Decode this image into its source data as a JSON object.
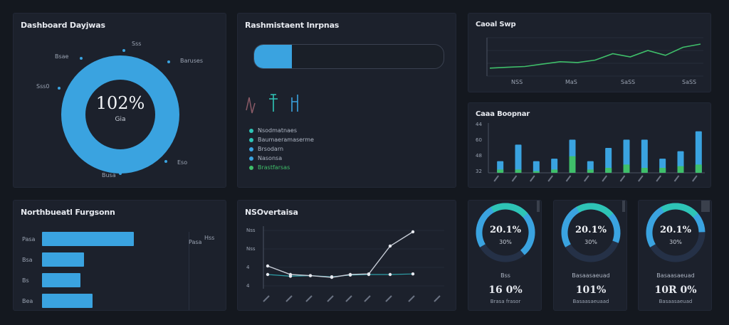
{
  "colors": {
    "background": "#14181f",
    "panel": "#1c212c",
    "accent_blue": "#3aa3e0",
    "accent_teal": "#2ec4b6",
    "accent_green": "#3fbf6a",
    "track": "#253147"
  },
  "donut_panel": {
    "title": "Dashboard Dayjwas",
    "value": "102%",
    "sub": "Gia",
    "labels": [
      "Bsae",
      "Sss",
      "Baruses",
      "Sss0",
      "Eso",
      "Busa"
    ],
    "percent": 100
  },
  "progress_panel": {
    "title": "Rashmistaent Inrpnas",
    "progress_value": 0.2,
    "legend": [
      {
        "label": "Nsodmatnaes",
        "color": "#2ec4b6"
      },
      {
        "label": "Baumaeramaserme",
        "color": "#2ec4b6"
      },
      {
        "label": "Brsodarn",
        "color": "#3aa3e0"
      },
      {
        "label": "Nasonsa",
        "color": "#3aa3e0"
      },
      {
        "label": "Brastfarsas",
        "color": "#3fbf6a"
      }
    ]
  },
  "spark_panel": {
    "title": "Caoal Swp",
    "x_labels": [
      "NSS",
      "MaS",
      "SaSS",
      "SaSS"
    ]
  },
  "bars_panel": {
    "title": "Caaa Boopnar",
    "y_labels": [
      "44",
      "60",
      "48",
      "32"
    ]
  },
  "hbar_panel": {
    "title": "Northbueatl Furgsonn",
    "rows": [
      {
        "label": "Pasa",
        "value": 0.83
      },
      {
        "label": "Bsa",
        "value": 0.38
      },
      {
        "label": "Bs",
        "value": 0.35
      },
      {
        "label": "Bea",
        "value": 0.46
      }
    ],
    "side_labels": [
      "Pasa",
      "Hss"
    ]
  },
  "line_panel": {
    "title": "NSOvertaisa",
    "y_labels": [
      "Nss",
      "Nss",
      "4",
      "4"
    ]
  },
  "gauges": [
    {
      "value": "20.1%",
      "sub": "30%",
      "label": "Bss",
      "big": "16 0%",
      "caption": "Brasa frasor",
      "fraction": 0.72
    },
    {
      "value": "20.1%",
      "sub": "30%",
      "label": "Basaasaeuad",
      "big": "101%",
      "caption": "Basaasaeuaad",
      "fraction": 0.64
    },
    {
      "value": "20.1%",
      "sub": "30%",
      "label": "Basaasaeuad",
      "big": "10R 0%",
      "caption": "Basaasaeuad",
      "fraction": 0.58
    }
  ],
  "chart_data": [
    {
      "type": "pie",
      "title": "Dashboard Dayjwas",
      "values": [
        100
      ],
      "center_label": "102%"
    },
    {
      "type": "line",
      "title": "Caoal Swp",
      "x": [
        "NSS",
        "MaS",
        "SaSS",
        "SaSS"
      ],
      "series": [
        {
          "values": [
            5,
            5.5,
            6,
            7.5,
            9,
            8.5,
            10,
            14,
            12,
            16,
            13,
            18,
            20
          ]
        }
      ],
      "ylim": [
        0,
        24
      ]
    },
    {
      "type": "bar",
      "title": "Caaa Boopnar",
      "series": [
        {
          "name": "blue",
          "values": [
            14,
            34,
            14,
            17,
            40,
            14,
            30,
            40,
            40,
            17,
            26,
            50
          ]
        },
        {
          "name": "green",
          "values": [
            4,
            4,
            2,
            4,
            20,
            4,
            6,
            10,
            6,
            6,
            8,
            10
          ]
        }
      ],
      "ylim": [
        0,
        60
      ]
    },
    {
      "type": "bar",
      "title": "Northbueatl Furgsonn",
      "categories": [
        "Pasa",
        "Bsa",
        "Bs",
        "Bea"
      ],
      "values": [
        0.83,
        0.38,
        0.35,
        0.46
      ]
    },
    {
      "type": "line",
      "title": "NSOvertaisa",
      "series": [
        {
          "name": "dark",
          "values": [
            40,
            25,
            23,
            20,
            25,
            26,
            75,
            100
          ]
        },
        {
          "name": "light",
          "values": [
            25,
            22,
            23,
            21,
            24,
            25,
            25,
            26
          ]
        }
      ],
      "ylim": [
        0,
        110
      ]
    }
  ]
}
